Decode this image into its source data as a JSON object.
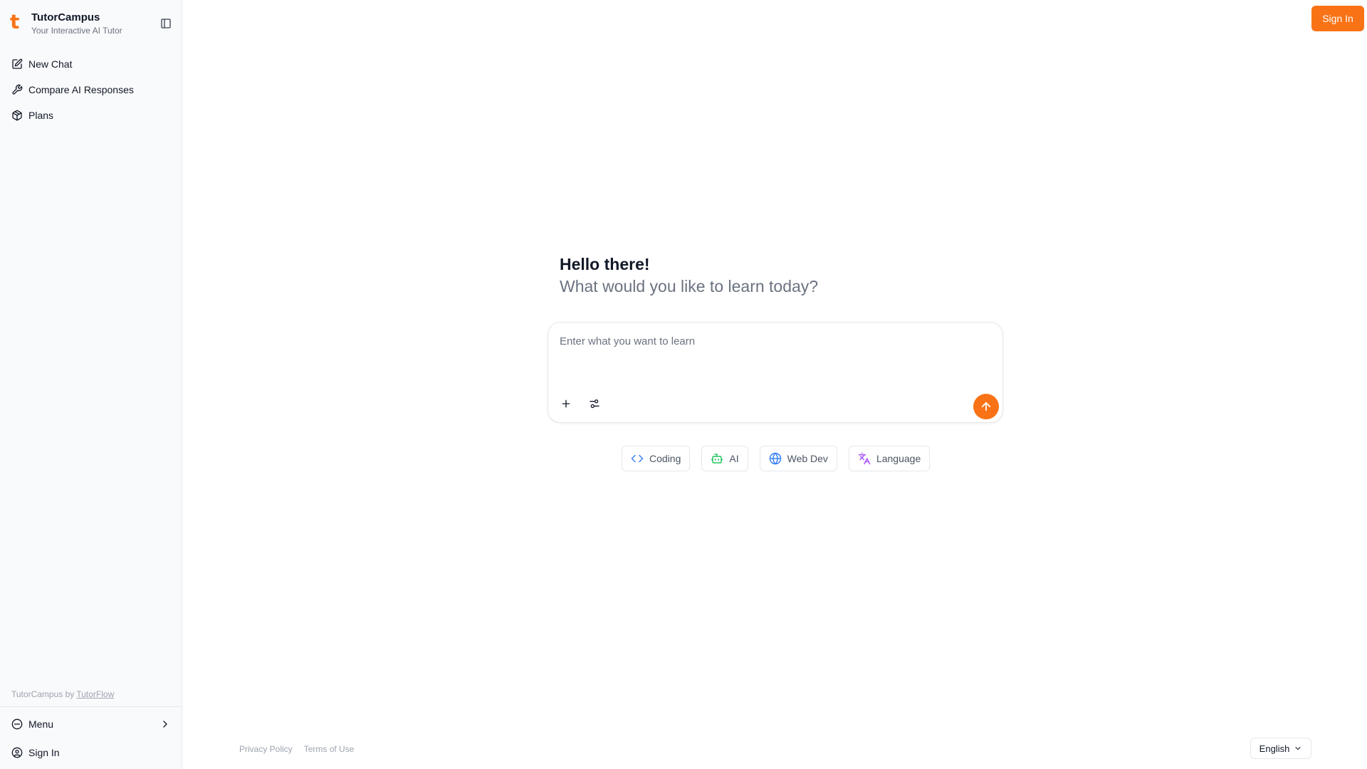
{
  "brand": {
    "logo_letter": "t",
    "name": "TutorCampus",
    "tagline": "Your Interactive AI Tutor"
  },
  "sidebar": {
    "items": [
      {
        "label": "New Chat",
        "icon": "edit-icon"
      },
      {
        "label": "Compare AI Responses",
        "icon": "wrench-icon"
      },
      {
        "label": "Plans",
        "icon": "package-icon"
      }
    ],
    "credit_prefix": "TutorCampus by ",
    "credit_link": "TutorFlow",
    "bottom": {
      "menu_label": "Menu",
      "signin_label": "Sign In"
    }
  },
  "header": {
    "signin_label": "Sign In"
  },
  "hero": {
    "title": "Hello there!",
    "subtitle": "What would you like to learn today?"
  },
  "prompt": {
    "placeholder": "Enter what you want to learn",
    "value": ""
  },
  "chips": [
    {
      "label": "Coding",
      "icon": "code-icon",
      "color": "#3b82f6"
    },
    {
      "label": "AI",
      "icon": "bot-icon",
      "color": "#22c55e"
    },
    {
      "label": "Web Dev",
      "icon": "globe-icon",
      "color": "#3b82f6"
    },
    {
      "label": "Language",
      "icon": "languages-icon",
      "color": "#a855f7"
    }
  ],
  "footer": {
    "privacy": "Privacy Policy",
    "terms": "Terms of Use"
  },
  "language": {
    "selected": "English"
  },
  "colors": {
    "accent": "#f97316"
  }
}
